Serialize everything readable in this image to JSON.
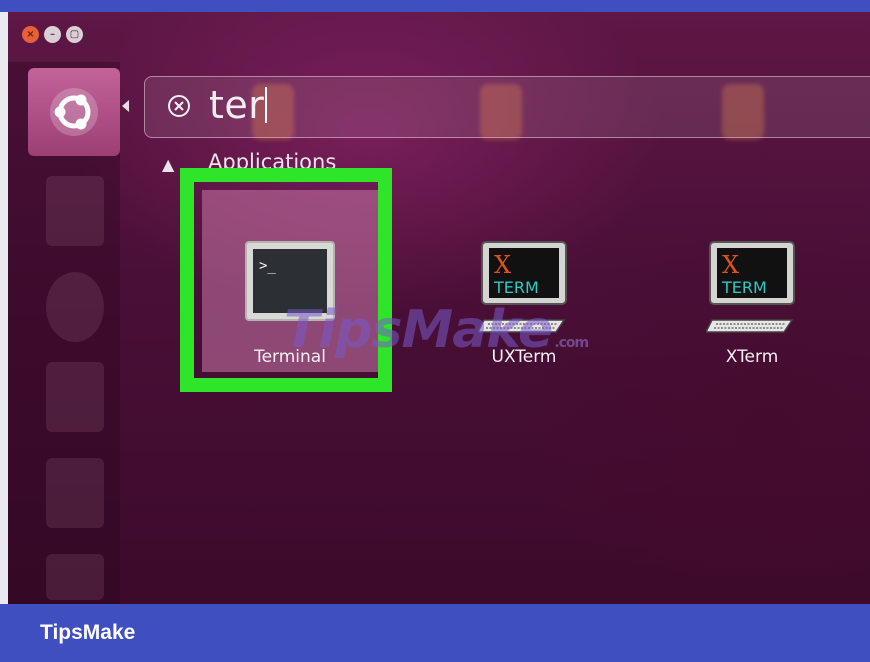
{
  "window": {
    "close_glyph": "×",
    "minimize_glyph": "–",
    "maximize_glyph": "▢"
  },
  "search": {
    "query": "ter",
    "clear_icon": "clear-search-icon"
  },
  "section": {
    "arrow": "▲",
    "title": "Applications"
  },
  "apps": [
    {
      "label": "Terminal",
      "icon": "terminal-icon",
      "selected": true
    },
    {
      "label": "UXTerm",
      "icon": "xterm-icon",
      "selected": false
    },
    {
      "label": "XTerm",
      "icon": "xterm-icon",
      "selected": false
    }
  ],
  "xterm_icon": {
    "letter": "X",
    "word": "TERM"
  },
  "watermark": {
    "brand": "TipsMake",
    "suffix": ".com"
  },
  "footer": {
    "brand": "TipsMake"
  },
  "colors": {
    "highlight": "#2fe52a",
    "footer_bg": "#3f4fc0",
    "desktop_bg": "#4a0f37"
  }
}
